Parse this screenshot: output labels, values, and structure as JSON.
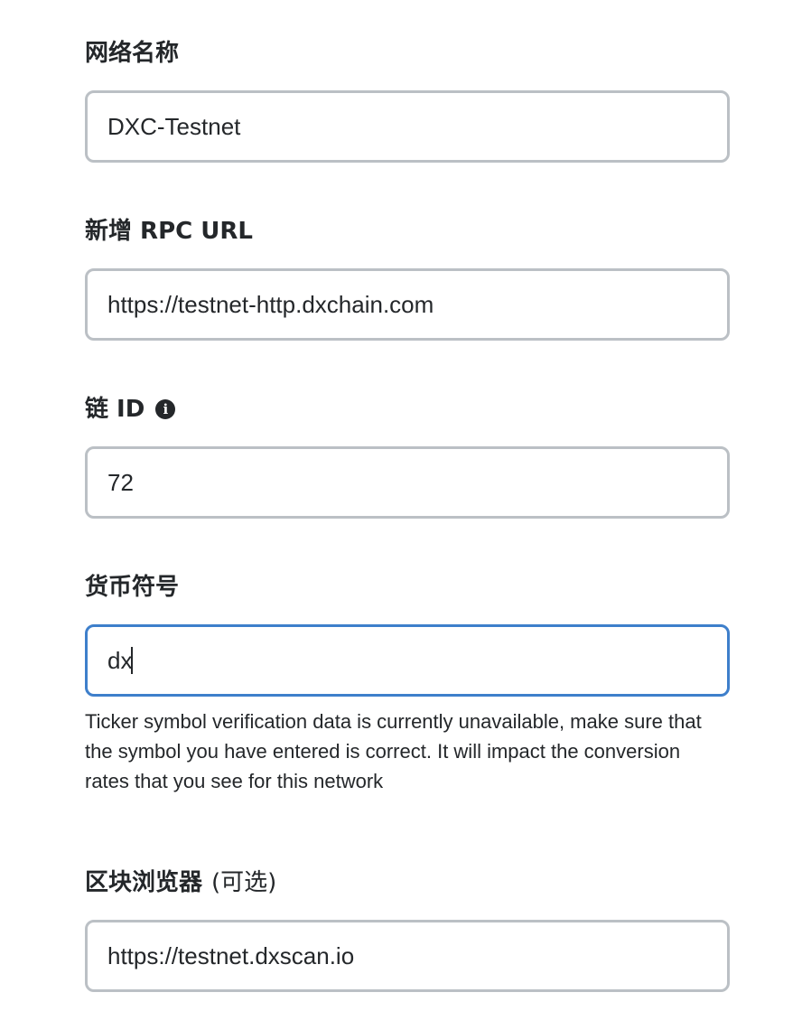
{
  "fields": [
    {
      "label": "网络名称",
      "value": "DXC-Testnet"
    },
    {
      "label": "新增 RPC URL",
      "value": "https://testnet-http.dxchain.com"
    },
    {
      "label": "链 ID",
      "value": "72",
      "icon": "info-icon"
    },
    {
      "label": "货币符号",
      "value": "dx",
      "focused": true,
      "warning": "Ticker symbol verification data is currently unavailable, make sure that the symbol you have entered is correct. It will impact the conversion rates that you see for this network"
    },
    {
      "label": "区块浏览器",
      "optional_label": "(可选)",
      "value": "https://testnet.dxscan.io"
    }
  ],
  "colors": {
    "text": "#24272a",
    "input_border": "#bbc0c5",
    "input_focus_border": "#3e7fcb"
  }
}
